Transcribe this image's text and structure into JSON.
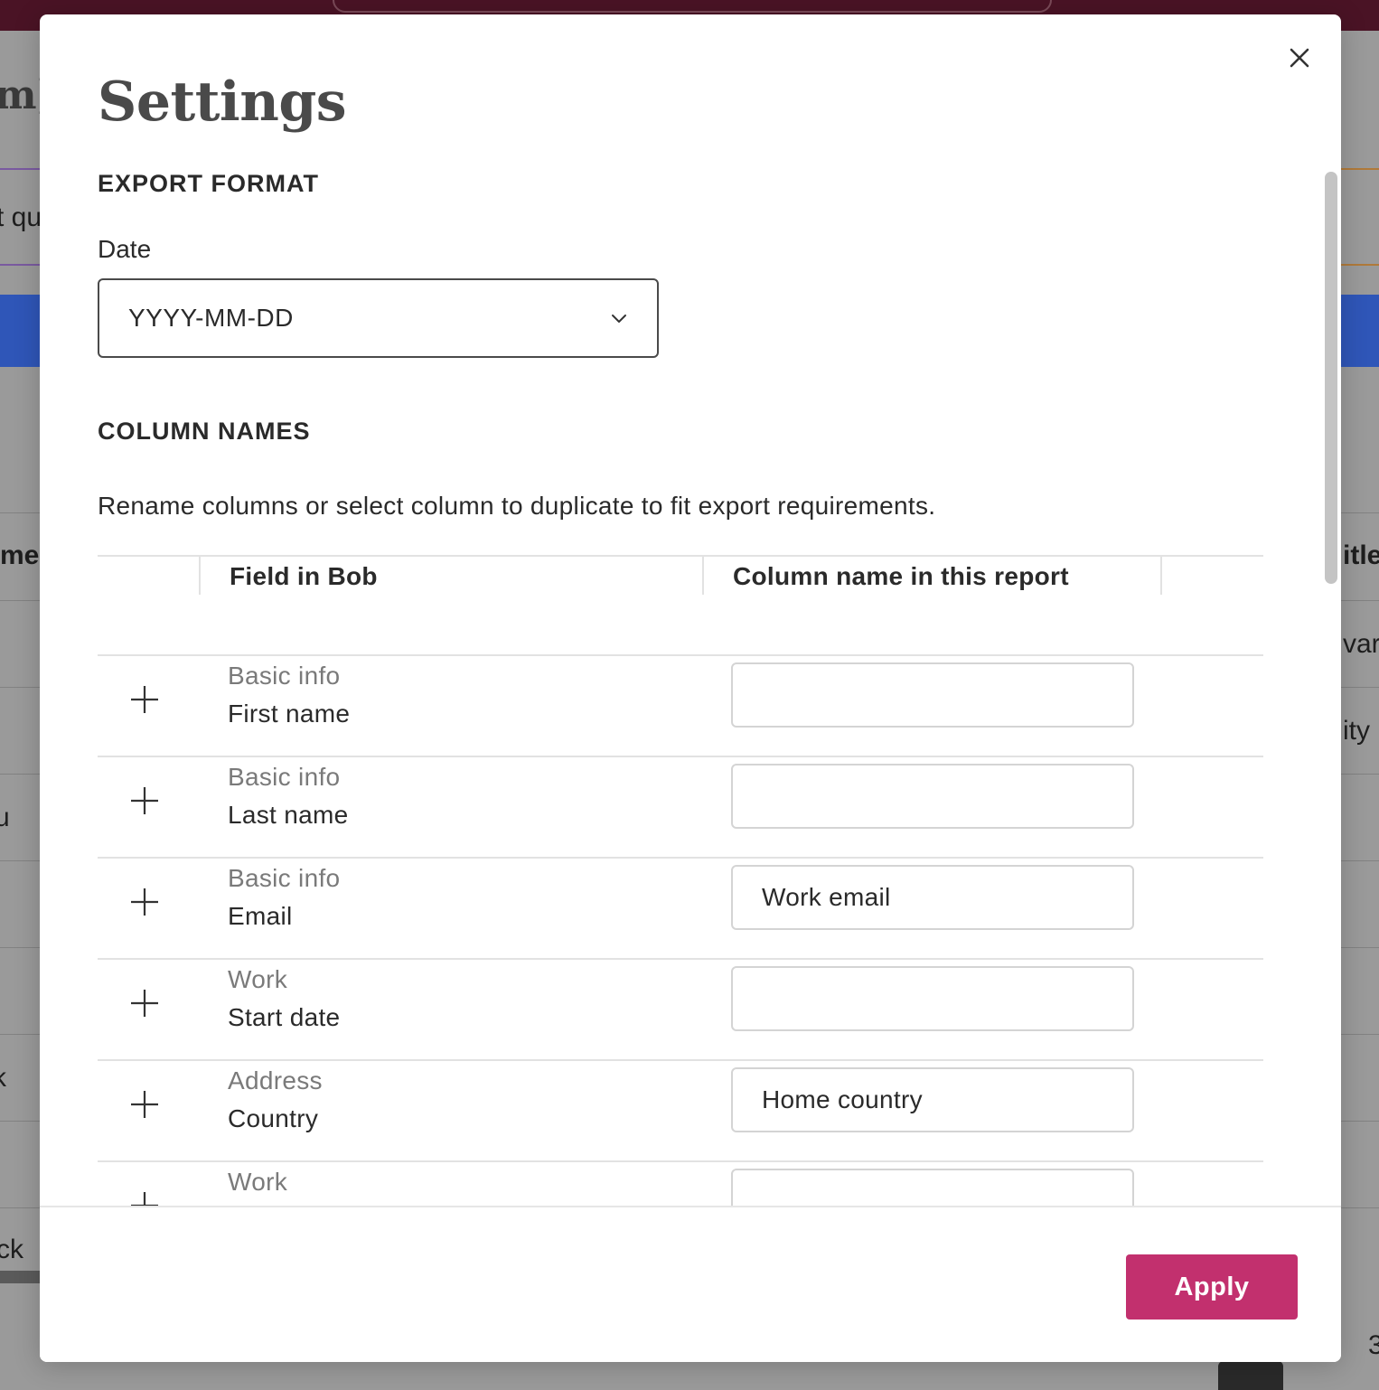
{
  "background": {
    "fragments": [
      "m]",
      "t qu",
      "me",
      "itle",
      "var",
      "ity",
      "u",
      "k",
      "ck",
      "3"
    ]
  },
  "modal": {
    "title": "Settings",
    "close_icon": "close-icon",
    "export_format": {
      "heading": "EXPORT FORMAT",
      "date_label": "Date",
      "date_value": "YYYY-MM-DD"
    },
    "column_names": {
      "heading": "COLUMN NAMES",
      "description": "Rename columns or select column to duplicate to fit export requirements.",
      "table": {
        "headers": [
          "Field in Bob",
          "Column name in this report"
        ],
        "rows": [
          {
            "category": "Basic info",
            "field": "First name",
            "value": ""
          },
          {
            "category": "Basic info",
            "field": "Last name",
            "value": ""
          },
          {
            "category": "Basic info",
            "field": "Email",
            "value": "Work email"
          },
          {
            "category": "Work",
            "field": "Start date",
            "value": ""
          },
          {
            "category": "Address",
            "field": "Country",
            "value": "Home country"
          },
          {
            "category": "Work",
            "field": "",
            "value": ""
          }
        ]
      }
    },
    "footer": {
      "apply_label": "Apply"
    },
    "colors": {
      "accent": "#c2306e",
      "topbar": "#4a1325",
      "bg_blue": "#2f56b8"
    }
  }
}
